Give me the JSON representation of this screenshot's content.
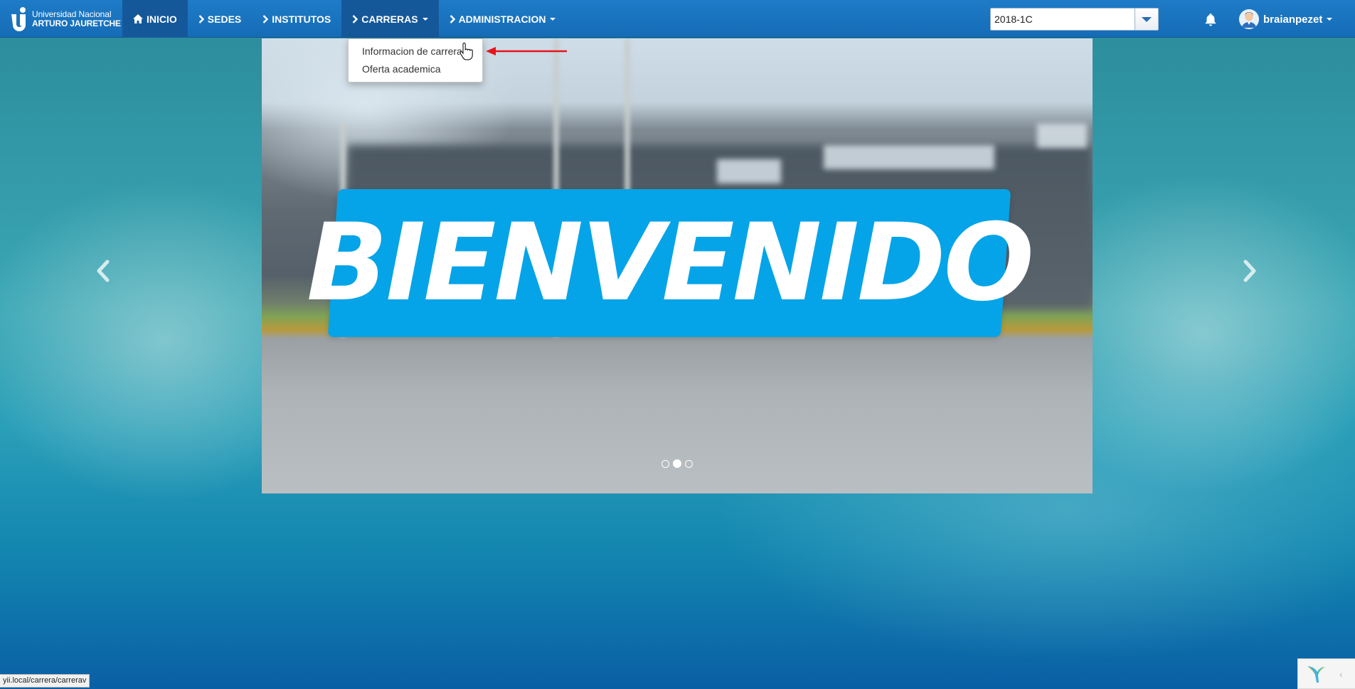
{
  "brand": {
    "line1": "Universidad Nacional",
    "line2": "ARTURO JAURETCHE"
  },
  "nav": {
    "items": [
      {
        "label": "INICIO",
        "icon": "home-icon",
        "active": true
      },
      {
        "label": "SEDES",
        "icon": "chevron-right-icon"
      },
      {
        "label": "INSTITUTOS",
        "icon": "chevron-right-icon"
      },
      {
        "label": "CARRERAS",
        "icon": "chevron-right-icon",
        "dropdown": true,
        "open": true
      },
      {
        "label": "ADMINISTRACION",
        "icon": "chevron-right-icon",
        "dropdown": true
      }
    ]
  },
  "period": {
    "selected": "2018-1C"
  },
  "user": {
    "name": "braianpezet"
  },
  "dropdown": {
    "items": [
      "Informacion de carreras",
      "Oferta academica"
    ]
  },
  "carousel": {
    "banner_text": "BIENVENIDO",
    "active_index": 1,
    "count": 3
  },
  "status": {
    "url": "yii.local/carrera/carrerav"
  },
  "colors": {
    "navbar": "#1a73c0",
    "active_nav": "#15589a",
    "banner": "#05a4e8",
    "annotation_arrow": "#e8141c"
  }
}
